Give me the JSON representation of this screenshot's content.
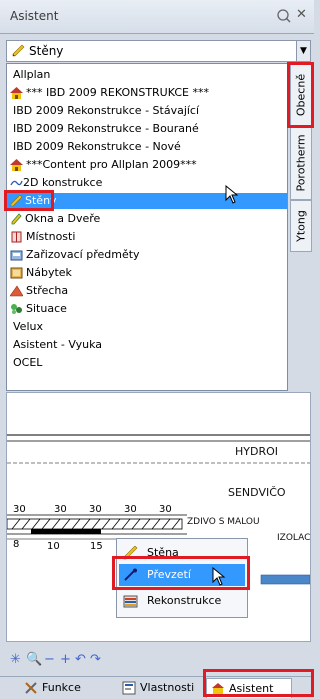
{
  "panel": {
    "title": "Asistent"
  },
  "combo": {
    "value": "Stěny",
    "icon": "pencil-wall-icon"
  },
  "dropdown": {
    "items": [
      {
        "label": "Allplan",
        "icon": ""
      },
      {
        "label": "*** IBD 2009 REKONSTRUKCE ***",
        "icon": "house-icon"
      },
      {
        "label": "IBD 2009 Rekonstrukce - Stávající",
        "icon": ""
      },
      {
        "label": "IBD 2009 Rekonstrukce - Bourané",
        "icon": ""
      },
      {
        "label": "IBD 2009 Rekonstrukce - Nové",
        "icon": ""
      },
      {
        "label": "***Content pro Allplan 2009***",
        "icon": "house-icon"
      },
      {
        "label": "2D konstrukce",
        "icon": "line-2d-icon"
      },
      {
        "label": "Stěny",
        "icon": "pencil-wall-icon",
        "selected": true
      },
      {
        "label": "Okna a Dveře",
        "icon": "window-door-icon"
      },
      {
        "label": "Místnosti",
        "icon": "room-icon"
      },
      {
        "label": "Zařizovací předměty",
        "icon": "fixture-icon"
      },
      {
        "label": "Nábytek",
        "icon": "furniture-icon"
      },
      {
        "label": "Střecha",
        "icon": "roof-icon"
      },
      {
        "label": "Situace",
        "icon": "site-icon"
      },
      {
        "label": "Velux",
        "icon": ""
      },
      {
        "label": "Asistent - Vyuka",
        "icon": ""
      },
      {
        "label": "OCEL",
        "icon": ""
      }
    ]
  },
  "side_tabs": [
    {
      "label": "Obecně",
      "active": true
    },
    {
      "label": "Porotherm"
    },
    {
      "label": "Ytong"
    }
  ],
  "drawing": {
    "text_hydro": "HYDROI",
    "text_sendvico": "SENDVIČO",
    "text_zdivo": "ZDIVO S MALOU",
    "text_izolac": "IZOLAC",
    "dims_top": [
      "30",
      "30",
      "30",
      "30",
      "30"
    ],
    "dims_bottom": [
      "8",
      "10",
      "15"
    ]
  },
  "context_menu": {
    "items": [
      {
        "label": "Stěna",
        "icon": "pencil-wall-icon"
      },
      {
        "label": "Převzetí",
        "icon": "pipette-icon",
        "highlighted": true
      },
      {
        "label": "Rekonstrukce",
        "icon": "reconstruction-icon"
      }
    ]
  },
  "zoombar": {
    "icons": [
      "✳",
      "🔍",
      "−",
      "+",
      "↶",
      "↷"
    ]
  },
  "bottom_tabs": [
    {
      "label": "Funkce",
      "icon": "tools-icon"
    },
    {
      "label": "Vlastnosti",
      "icon": "properties-icon"
    },
    {
      "label": "Asistent",
      "icon": "assistant-icon",
      "active": true
    }
  ],
  "colors": {
    "accent": "#3399ff",
    "highlight_box": "#e01b24"
  }
}
